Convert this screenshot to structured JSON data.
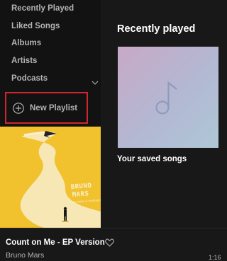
{
  "sidebar": {
    "items": [
      {
        "label": "Recently Played"
      },
      {
        "label": "Liked Songs"
      },
      {
        "label": "Albums"
      },
      {
        "label": "Artists"
      },
      {
        "label": "Podcasts"
      }
    ],
    "new_playlist_label": "New Playlist",
    "highlight_color": "#d0262d"
  },
  "main": {
    "section_title": "Recently played",
    "cards": [
      {
        "label": "Your saved songs",
        "icon": "music-note-icon"
      }
    ]
  },
  "album_art": {
    "artist_text": "BRUNO MARS",
    "icon": "album-cover"
  },
  "player": {
    "track_title": "Count on Me - EP Version",
    "artist": "Bruno Mars",
    "elapsed": "1:16"
  },
  "colors": {
    "sidebar_bg": "#121212",
    "main_bg": "#181818",
    "cover_yellow": "#f2c12e"
  }
}
